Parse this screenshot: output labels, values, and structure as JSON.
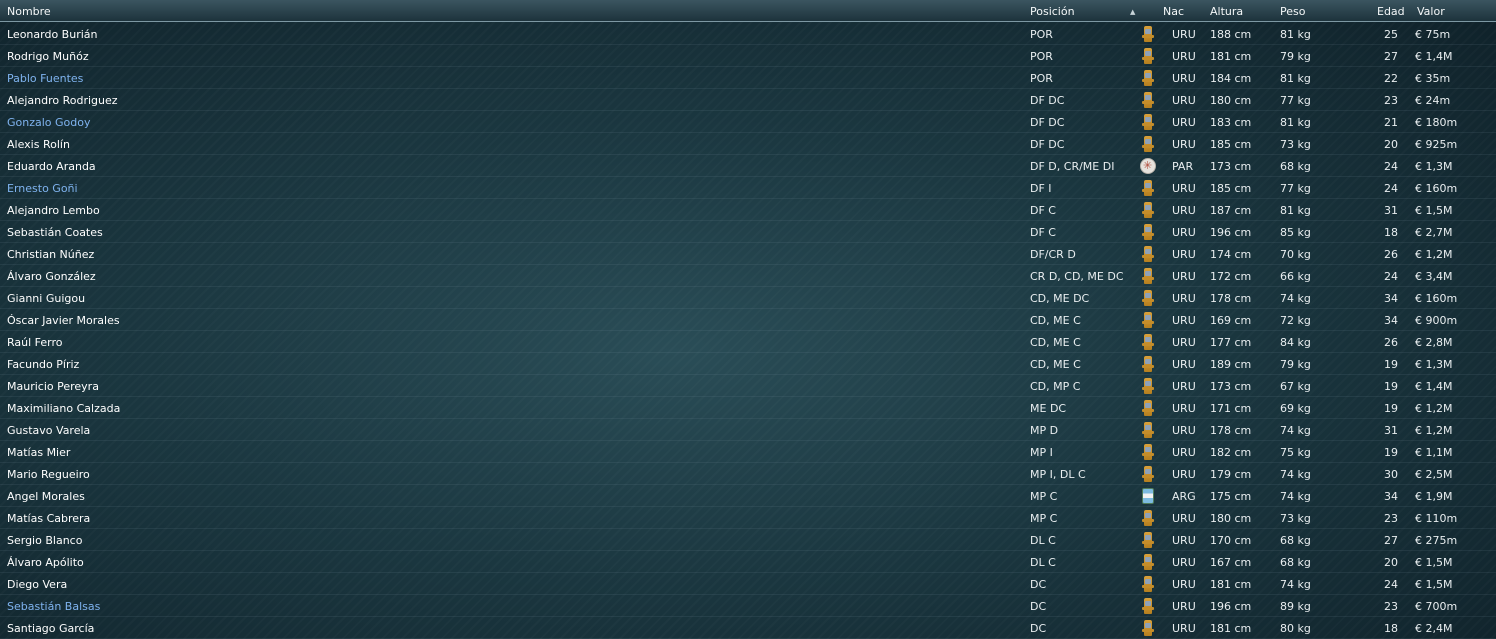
{
  "header": {
    "nombre": "Nombre",
    "posicion": "Posición",
    "sort_indicator": "▲",
    "nac": "Nac",
    "altura": "Altura",
    "peso": "Peso",
    "edad": "Edad",
    "valor": "Valor"
  },
  "colors": {
    "highlight_name": "#7fb3ef",
    "normal_name": "#ffffff",
    "header_bg": "#2d4651"
  },
  "players": [
    {
      "nombre": "Leonardo Burián",
      "posicion": "POR",
      "flag": "uru-flag-icon",
      "nac": "URU",
      "altura": "188 cm",
      "peso": "81 kg",
      "edad": "25",
      "valor": "€ 75m",
      "highlight": false
    },
    {
      "nombre": "Rodrigo Muñóz",
      "posicion": "POR",
      "flag": "uru-flag-icon",
      "nac": "URU",
      "altura": "181 cm",
      "peso": "79 kg",
      "edad": "27",
      "valor": "€ 1,4M",
      "highlight": false
    },
    {
      "nombre": "Pablo Fuentes",
      "posicion": "POR",
      "flag": "uru-flag-icon",
      "nac": "URU",
      "altura": "184 cm",
      "peso": "81 kg",
      "edad": "22",
      "valor": "€ 35m",
      "highlight": true
    },
    {
      "nombre": "Alejandro Rodriguez",
      "posicion": "DF DC",
      "flag": "uru-flag-icon",
      "nac": "URU",
      "altura": "180 cm",
      "peso": "77 kg",
      "edad": "23",
      "valor": "€ 24m",
      "highlight": false
    },
    {
      "nombre": "Gonzalo Godoy",
      "posicion": "DF DC",
      "flag": "uru-flag-icon",
      "nac": "URU",
      "altura": "183 cm",
      "peso": "81 kg",
      "edad": "21",
      "valor": "€ 180m",
      "highlight": true
    },
    {
      "nombre": "Alexis Rolín",
      "posicion": "DF DC",
      "flag": "uru-flag-icon",
      "nac": "URU",
      "altura": "185 cm",
      "peso": "73 kg",
      "edad": "20",
      "valor": "€ 925m",
      "highlight": false
    },
    {
      "nombre": "Eduardo Aranda",
      "posicion": "DF D, CR/ME DI",
      "flag": "par-flag-icon",
      "nac": "PAR",
      "altura": "173 cm",
      "peso": "68 kg",
      "edad": "24",
      "valor": "€ 1,3M",
      "highlight": false
    },
    {
      "nombre": "Ernesto Goñi",
      "posicion": "DF I",
      "flag": "uru-flag-icon",
      "nac": "URU",
      "altura": "185 cm",
      "peso": "77 kg",
      "edad": "24",
      "valor": "€ 160m",
      "highlight": true
    },
    {
      "nombre": "Alejandro Lembo",
      "posicion": "DF C",
      "flag": "uru-flag-icon",
      "nac": "URU",
      "altura": "187 cm",
      "peso": "81 kg",
      "edad": "31",
      "valor": "€ 1,5M",
      "highlight": false
    },
    {
      "nombre": "Sebastián Coates",
      "posicion": "DF C",
      "flag": "uru-flag-icon",
      "nac": "URU",
      "altura": "196 cm",
      "peso": "85 kg",
      "edad": "18",
      "valor": "€ 2,7M",
      "highlight": false
    },
    {
      "nombre": "Christian Núñez",
      "posicion": "DF/CR D",
      "flag": "uru-flag-icon",
      "nac": "URU",
      "altura": "174 cm",
      "peso": "70 kg",
      "edad": "26",
      "valor": "€ 1,2M",
      "highlight": false
    },
    {
      "nombre": "Álvaro González",
      "posicion": "CR D, CD, ME DC",
      "flag": "uru-flag-icon",
      "nac": "URU",
      "altura": "172 cm",
      "peso": "66 kg",
      "edad": "24",
      "valor": "€ 3,4M",
      "highlight": false
    },
    {
      "nombre": "Gianni Guigou",
      "posicion": "CD, ME DC",
      "flag": "uru-flag-icon",
      "nac": "URU",
      "altura": "178 cm",
      "peso": "74 kg",
      "edad": "34",
      "valor": "€ 160m",
      "highlight": false
    },
    {
      "nombre": "Óscar Javier Morales",
      "posicion": "CD, ME C",
      "flag": "uru-flag-icon",
      "nac": "URU",
      "altura": "169 cm",
      "peso": "72 kg",
      "edad": "34",
      "valor": "€ 900m",
      "highlight": false
    },
    {
      "nombre": "Raúl Ferro",
      "posicion": "CD, ME C",
      "flag": "uru-flag-icon",
      "nac": "URU",
      "altura": "177 cm",
      "peso": "84 kg",
      "edad": "26",
      "valor": "€ 2,8M",
      "highlight": false
    },
    {
      "nombre": "Facundo Píriz",
      "posicion": "CD, ME C",
      "flag": "uru-flag-icon",
      "nac": "URU",
      "altura": "189 cm",
      "peso": "79 kg",
      "edad": "19",
      "valor": "€ 1,3M",
      "highlight": false
    },
    {
      "nombre": "Mauricio Pereyra",
      "posicion": "CD, MP C",
      "flag": "uru-flag-icon",
      "nac": "URU",
      "altura": "173 cm",
      "peso": "67 kg",
      "edad": "19",
      "valor": "€ 1,4M",
      "highlight": false
    },
    {
      "nombre": "Maximiliano Calzada",
      "posicion": "ME DC",
      "flag": "uru-flag-icon",
      "nac": "URU",
      "altura": "171 cm",
      "peso": "69 kg",
      "edad": "19",
      "valor": "€ 1,2M",
      "highlight": false
    },
    {
      "nombre": "Gustavo Varela",
      "posicion": "MP D",
      "flag": "uru-flag-icon",
      "nac": "URU",
      "altura": "178 cm",
      "peso": "74 kg",
      "edad": "31",
      "valor": "€ 1,2M",
      "highlight": false
    },
    {
      "nombre": "Matías Mier",
      "posicion": "MP I",
      "flag": "uru-flag-icon",
      "nac": "URU",
      "altura": "182 cm",
      "peso": "75 kg",
      "edad": "19",
      "valor": "€ 1,1M",
      "highlight": false
    },
    {
      "nombre": "Mario Regueiro",
      "posicion": "MP I, DL C",
      "flag": "uru-flag-icon",
      "nac": "URU",
      "altura": "179 cm",
      "peso": "74 kg",
      "edad": "30",
      "valor": "€ 2,5M",
      "highlight": false
    },
    {
      "nombre": "Angel Morales",
      "posicion": "MP C",
      "flag": "arg-flag-icon",
      "nac": "ARG",
      "altura": "175 cm",
      "peso": "74 kg",
      "edad": "34",
      "valor": "€ 1,9M",
      "highlight": false
    },
    {
      "nombre": "Matías Cabrera",
      "posicion": "MP C",
      "flag": "uru-flag-icon",
      "nac": "URU",
      "altura": "180 cm",
      "peso": "73 kg",
      "edad": "23",
      "valor": "€ 110m",
      "highlight": false
    },
    {
      "nombre": "Sergio Blanco",
      "posicion": "DL C",
      "flag": "uru-flag-icon",
      "nac": "URU",
      "altura": "170 cm",
      "peso": "68 kg",
      "edad": "27",
      "valor": "€ 275m",
      "highlight": false
    },
    {
      "nombre": "Álvaro Apólito",
      "posicion": "DL C",
      "flag": "uru-flag-icon",
      "nac": "URU",
      "altura": "167 cm",
      "peso": "68 kg",
      "edad": "20",
      "valor": "€ 1,5M",
      "highlight": false
    },
    {
      "nombre": "Diego Vera",
      "posicion": "DC",
      "flag": "uru-flag-icon",
      "nac": "URU",
      "altura": "181 cm",
      "peso": "74 kg",
      "edad": "24",
      "valor": "€ 1,5M",
      "highlight": false
    },
    {
      "nombre": "Sebastián Balsas",
      "posicion": "DC",
      "flag": "uru-flag-icon",
      "nac": "URU",
      "altura": "196 cm",
      "peso": "89 kg",
      "edad": "23",
      "valor": "€ 700m",
      "highlight": true
    },
    {
      "nombre": "Santiago García",
      "posicion": "DC",
      "flag": "uru-flag-icon",
      "nac": "URU",
      "altura": "181 cm",
      "peso": "80 kg",
      "edad": "18",
      "valor": "€ 2,4M",
      "highlight": false
    }
  ]
}
